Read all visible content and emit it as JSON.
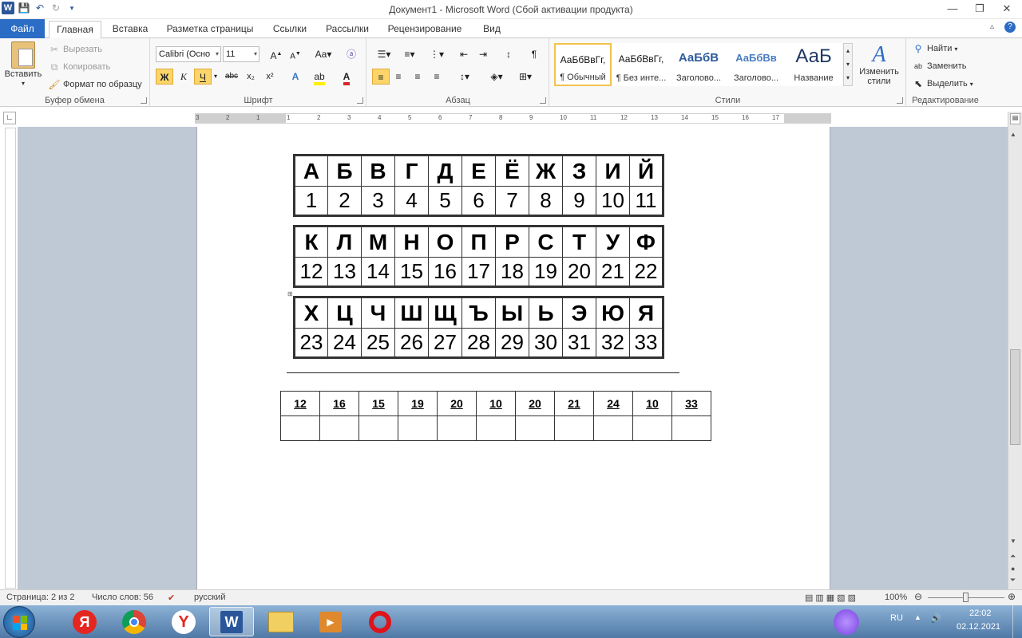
{
  "titlebar": {
    "title": "Документ1  -  Microsoft Word (Сбой активации продукта)",
    "app_icon": "W"
  },
  "tabs": [
    "Файл",
    "Главная",
    "Вставка",
    "Разметка страницы",
    "Ссылки",
    "Рассылки",
    "Рецензирование",
    "Вид"
  ],
  "ribbon": {
    "clipboard": {
      "paste": "Вставить",
      "cut": "Вырезать",
      "copy": "Копировать",
      "format_painter": "Формат по образцу",
      "label": "Буфер обмена"
    },
    "font": {
      "font_name": "Calibri (Осно",
      "font_size": "11",
      "bold": "Ж",
      "italic": "К",
      "underline": "Ч",
      "strike": "abc",
      "sub": "x₂",
      "sup": "x²",
      "label": "Шрифт"
    },
    "paragraph": {
      "label": "Абзац"
    },
    "styles": {
      "items": [
        {
          "preview": "АаБбВвГг,",
          "name": "¶ Обычный"
        },
        {
          "preview": "АаБбВвГг,",
          "name": "¶ Без инте..."
        },
        {
          "preview": "АаБбВ",
          "name": "Заголово..."
        },
        {
          "preview": "АаБбВв",
          "name": "Заголово..."
        },
        {
          "preview": "АаБ",
          "name": "Название"
        }
      ],
      "change_styles": "Изменить стили",
      "label": "Стили"
    },
    "editing": {
      "find": "Найти",
      "replace": "Заменить",
      "select": "Выделить",
      "label": "Редактирование"
    }
  },
  "ruler": {
    "ticks": [
      "3",
      "2",
      "1",
      "1",
      "2",
      "3",
      "4",
      "5",
      "6",
      "7",
      "8",
      "9",
      "10",
      "11",
      "12",
      "13",
      "14",
      "15",
      "16",
      "17"
    ]
  },
  "document": {
    "alphabet_tables": [
      {
        "letters": [
          "А",
          "Б",
          "В",
          "Г",
          "Д",
          "Е",
          "Ё",
          "Ж",
          "З",
          "И",
          "Й"
        ],
        "numbers": [
          "1",
          "2",
          "3",
          "4",
          "5",
          "6",
          "7",
          "8",
          "9",
          "10",
          "11"
        ]
      },
      {
        "letters": [
          "К",
          "Л",
          "М",
          "Н",
          "О",
          "П",
          "Р",
          "С",
          "Т",
          "У",
          "Ф"
        ],
        "numbers": [
          "12",
          "13",
          "14",
          "15",
          "16",
          "17",
          "18",
          "19",
          "20",
          "21",
          "22"
        ]
      },
      {
        "letters": [
          "Х",
          "Ц",
          "Ч",
          "Ш",
          "Щ",
          "Ъ",
          "Ы",
          "Ь",
          "Э",
          "Ю",
          "Я"
        ],
        "numbers": [
          "23",
          "24",
          "25",
          "26",
          "27",
          "28",
          "29",
          "30",
          "31",
          "32",
          "33"
        ]
      }
    ],
    "code_table": {
      "codes": [
        "12",
        "16",
        "15",
        "19",
        "20",
        "10",
        "20",
        "21",
        "24",
        "10",
        "33"
      ],
      "answers": [
        "",
        "",
        "",
        "",
        "",
        "",
        "",
        "",
        "",
        "",
        ""
      ]
    }
  },
  "statusbar": {
    "page": "Страница: 2 из 2",
    "words": "Число слов: 56",
    "language": "русский",
    "zoom": "100%"
  },
  "taskbar": {
    "lang": "RU",
    "time": "22:02",
    "date": "02.12.2021"
  }
}
